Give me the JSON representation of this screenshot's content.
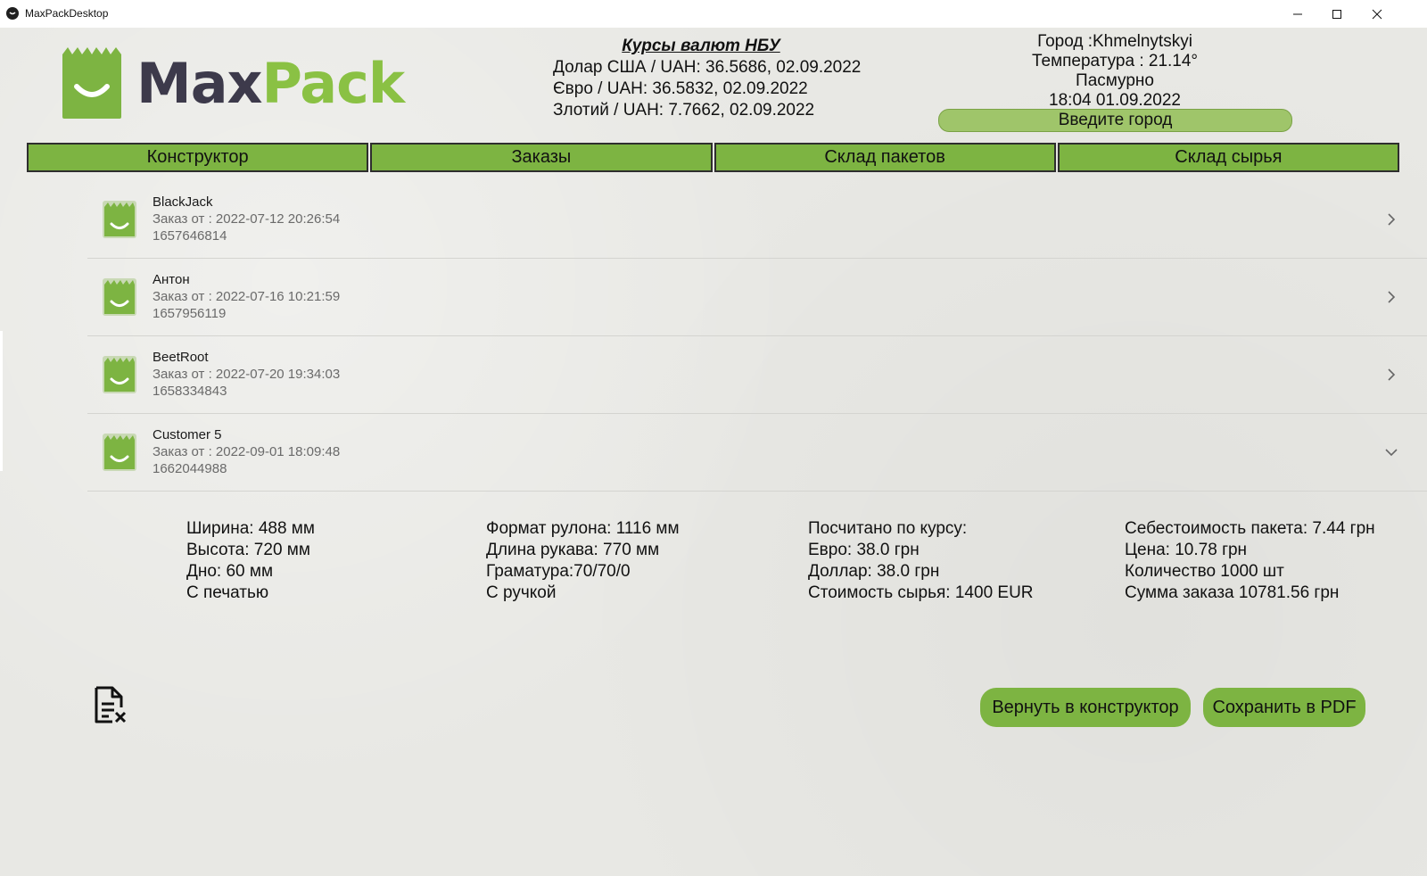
{
  "window": {
    "title": "MaxPackDesktop"
  },
  "logo": {
    "max": "Max",
    "pack": "Pack"
  },
  "rates": {
    "title": "Курсы валют НБУ",
    "lines": [
      "Долар США / UAH: 36.5686, 02.09.2022",
      "Євро / UAH: 36.5832, 02.09.2022",
      "Злотий / UAH: 7.7662, 02.09.2022"
    ]
  },
  "weather": {
    "city": "Город :Khmelnytskyi",
    "temperature": "Температура : 21.14°",
    "condition": "Пасмурно",
    "datetime": "18:04 01.09.2022",
    "city_button": "Введите город"
  },
  "tabs": [
    "Конструктор",
    "Заказы",
    "Склад пакетов",
    "Склад сырья"
  ],
  "orders": [
    {
      "name": "BlackJack",
      "date": "Заказ от : 2022-07-12 20:26:54",
      "id": "1657646814",
      "expanded": false
    },
    {
      "name": "Антон",
      "date": "Заказ от : 2022-07-16 10:21:59",
      "id": "1657956119",
      "expanded": false
    },
    {
      "name": "BeetRoot",
      "date": "Заказ от : 2022-07-20 19:34:03",
      "id": "1658334843",
      "expanded": false
    },
    {
      "name": "Customer 5",
      "date": "Заказ от : 2022-09-01 18:09:48",
      "id": "1662044988",
      "expanded": true
    }
  ],
  "details": {
    "col1": [
      "Ширина: 488 мм",
      "Высота: 720 мм",
      "Дно: 60 мм",
      "С печатью"
    ],
    "col2": [
      "Формат рулона: 1116 мм",
      "Длина рукава: 770 мм",
      "Граматура:70/70/0",
      "С ручкой"
    ],
    "col3": [
      "Посчитано по курсу:",
      "Евро: 38.0 грн",
      "Доллар: 38.0 грн",
      "Стоимость сырья: 1400 EUR"
    ],
    "col4": [
      "Себестоимость пакета: 7.44 грн",
      "Цена: 10.78 грн",
      "Количество 1000 шт",
      "Сумма заказа 10781.56 грн"
    ]
  },
  "actions": {
    "return_label": "Вернуть в конструктор",
    "pdf_label": "Сохранить в PDF",
    "delete_icon": "document-remove-icon"
  },
  "colors": {
    "accent_green": "#7db442",
    "logo_dark": "#3d3a4b",
    "logo_green": "#8ac144"
  }
}
